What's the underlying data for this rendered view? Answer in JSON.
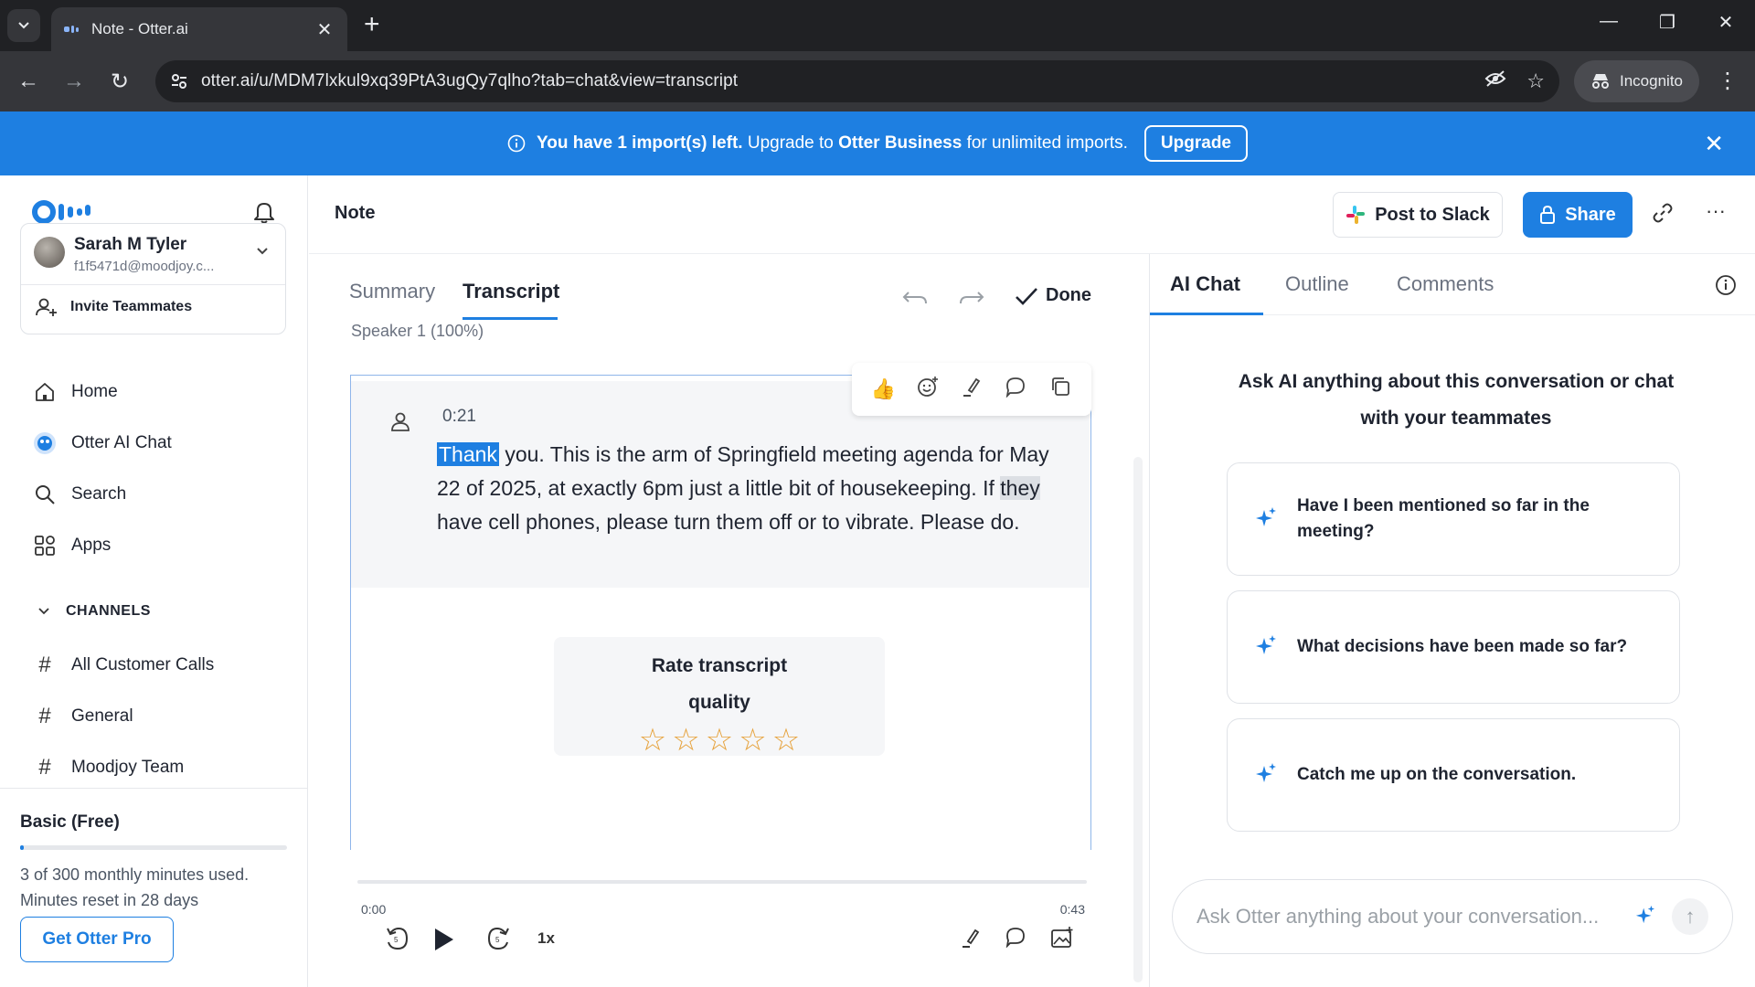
{
  "browser": {
    "tab_title": "Note - Otter.ai",
    "url": "otter.ai/u/MDM7lxkul9xq39PtA3ugQy7qlho?tab=chat&view=transcript",
    "incognito_label": "Incognito"
  },
  "banner": {
    "text_bold_1": "You have 1 import(s) left.",
    "text_2": "Upgrade to",
    "text_bold_3": "Otter Business",
    "text_4": "for unlimited imports.",
    "upgrade_label": "Upgrade"
  },
  "sidebar": {
    "user_name": "Sarah M Tyler",
    "user_email": "f1f5471d@moodjoy.c...",
    "invite_label": "Invite Teammates",
    "nav": [
      {
        "label": "Home",
        "icon": "home-icon"
      },
      {
        "label": "Otter AI Chat",
        "icon": "otter-ai-chat-icon"
      },
      {
        "label": "Search",
        "icon": "search-icon"
      },
      {
        "label": "Apps",
        "icon": "apps-icon"
      }
    ],
    "channels_heading": "CHANNELS",
    "channels": [
      "All Customer Calls",
      "General",
      "Moodjoy Team"
    ],
    "plan_title": "Basic (Free)",
    "minutes_used_fraction": 0.01,
    "usage_line_1": "3 of 300 monthly minutes used.",
    "usage_line_2": "Minutes reset in 28 days",
    "get_pro_label": "Get Otter Pro"
  },
  "header": {
    "title": "Note",
    "post_to_slack_label": "Post to Slack",
    "share_label": "Share"
  },
  "transcript": {
    "tabs": [
      "Summary",
      "Transcript"
    ],
    "active_tab": "Transcript",
    "done_label": "Done",
    "speaker_summary": "Speaker 1 (100%)",
    "block": {
      "timestamp": "0:21",
      "highlighted_word": "Thank",
      "text_part_1": " you. This is the arm of Springfield meeting agenda for May 22 of 2025, at exactly 6pm just a little bit of housekeeping. If ",
      "soft_highlight": "they",
      "text_part_2": " have cell phones, please turn them off or to vibrate. Please do."
    },
    "rate": {
      "title": "Rate transcript quality",
      "stars_total": 5,
      "stars_selected": 0
    }
  },
  "player": {
    "current_time": "0:00",
    "duration": "0:43",
    "playback_rate": "1x",
    "progress_fraction": 0
  },
  "right_panel": {
    "tabs": [
      "AI Chat",
      "Outline",
      "Comments"
    ],
    "active_tab": "AI Chat",
    "intro": "Ask AI anything about this conversation or chat with your teammates",
    "suggestions": [
      "Have I been mentioned so far in the meeting?",
      "What decisions have been made so far?",
      "Catch me up on the conversation."
    ],
    "input_placeholder": "Ask Otter anything about your conversation..."
  },
  "colors": {
    "accent": "#1e7fe1",
    "banner_bg": "#1e7fe1",
    "star": "#e6a23c"
  }
}
